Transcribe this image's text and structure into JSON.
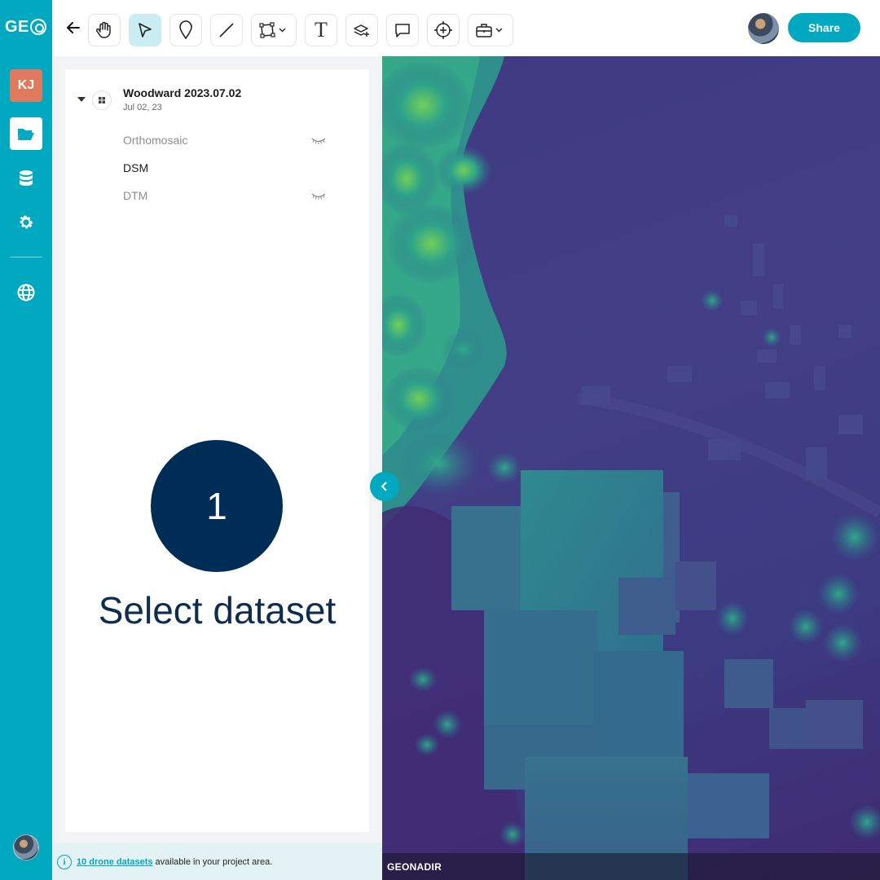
{
  "rail": {
    "logo_text": "GE",
    "user_initials": "KJ",
    "items": [
      {
        "icon": "folder-open-icon",
        "active": true
      },
      {
        "icon": "database-icon",
        "active": false
      },
      {
        "icon": "gear-icon",
        "active": false
      },
      {
        "icon": "globe-icon",
        "active": false
      }
    ]
  },
  "toolbar": {
    "tools": [
      {
        "icon": "hand-pan-icon",
        "active": false
      },
      {
        "icon": "pointer-select-icon",
        "active": true
      },
      {
        "icon": "map-pin-icon",
        "active": false
      },
      {
        "icon": "line-measure-icon",
        "active": false
      },
      {
        "icon": "polygon-icon",
        "active": false,
        "dropdown": true
      },
      {
        "icon": "text-tool-icon",
        "active": false,
        "glyph": "T"
      },
      {
        "icon": "add-layer-icon",
        "active": false
      },
      {
        "icon": "comment-icon",
        "active": false
      },
      {
        "icon": "add-location-icon",
        "active": false
      },
      {
        "icon": "toolbox-icon",
        "active": false,
        "dropdown": true
      }
    ],
    "share_label": "Share"
  },
  "panel": {
    "dataset_title": "Woodward 2023.07.02",
    "dataset_date": "Jul 02, 23",
    "layers": [
      {
        "label": "Orthomosaic",
        "visible": false
      },
      {
        "label": "DSM",
        "visible": true
      },
      {
        "label": "DTM",
        "visible": false
      }
    ],
    "step_number": "1",
    "step_label": "Select dataset"
  },
  "infobar": {
    "link_text": "10 drone datasets",
    "rest_text": "available in your project area."
  },
  "map": {
    "attribution": "GEONADIR",
    "palette": {
      "low": "#402a72",
      "mid": "#3f4a8a",
      "high": "#2a9d8f",
      "peak": "#7bd04f"
    }
  }
}
